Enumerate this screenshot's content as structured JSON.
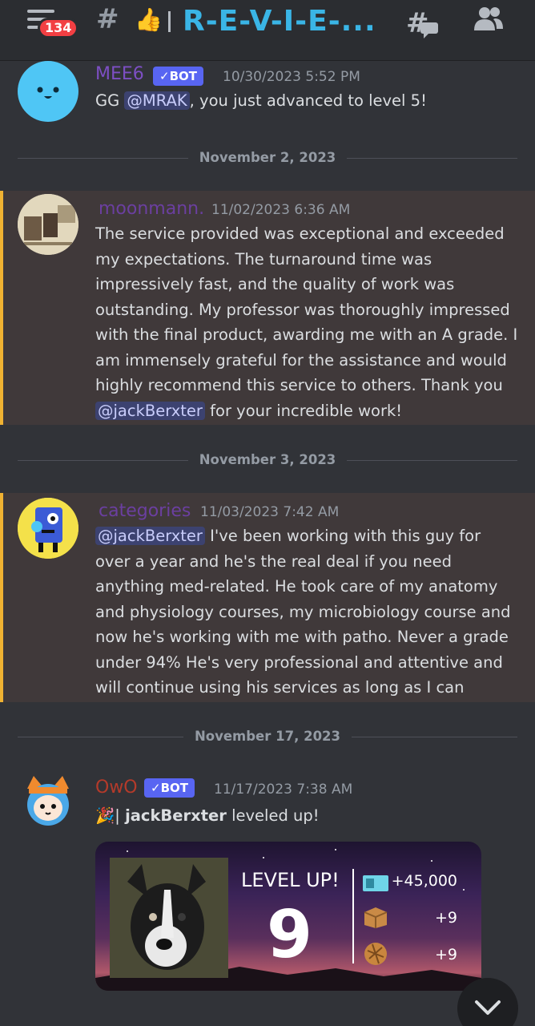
{
  "topbar": {
    "notification_count": "134",
    "hash_symbol": "#",
    "channel_emoji": "👍",
    "channel_name": "R-E-V-I-E-...",
    "icons": [
      "menu-icon",
      "hash-icon",
      "threads-icon",
      "members-icon"
    ]
  },
  "messages": [
    {
      "username": "MEE6",
      "username_color": "#7d4fc4",
      "bot_tag": "✓BOT",
      "timestamp": "10/30/2023 5:52 PM",
      "pre": "GG ",
      "mention": "@MRAK",
      "post": ", you just advanced to level 5!"
    },
    {
      "username": "moonmann.",
      "username_color": "#6b3fa0",
      "timestamp": "11/02/2023 6:36 AM",
      "text": "The service provided was exceptional and exceeded my expectations. The turnaround time was impressively fast, and the quality of work was outstanding. My professor was thoroughly impressed with the final product, awarding me with an A grade. I am immensely grateful for the assistance and would highly recommend this service to others. Thank you ",
      "mention": "@jackBerxter",
      "post": "  for your incredible work!"
    },
    {
      "username": "categories",
      "username_color": "#6b3fa0",
      "timestamp": "11/03/2023 7:42 AM",
      "mention": "@jackBerxter",
      "text": " I've been working with this guy for over a year and he's the real deal if you need anything med-related. He took care of my anatomy and physiology courses, my microbiology course and now he's working with me with patho. Never a grade under 94% He's very professional and attentive and will continue using his services as long as I can"
    },
    {
      "username": "OwO",
      "username_color": "#b43a2a",
      "bot_tag": "✓BOT",
      "timestamp": "11/17/2023 7:38 AM",
      "emoji": "🎉",
      "separator": "| ",
      "bold_user": "jackBerxter",
      "text": " leveled up!"
    }
  ],
  "dividers": [
    "November 2, 2023",
    "November 3, 2023",
    "November 17, 2023"
  ],
  "level_card": {
    "title": "LEVEL UP!",
    "level": "9",
    "rewards": [
      {
        "icon": "cowoncy-icon",
        "value": "+45,000"
      },
      {
        "icon": "crate-icon",
        "value": "+9"
      },
      {
        "icon": "cookie-icon",
        "value": "+9"
      }
    ]
  },
  "scroll_button": "chevron-down-icon"
}
